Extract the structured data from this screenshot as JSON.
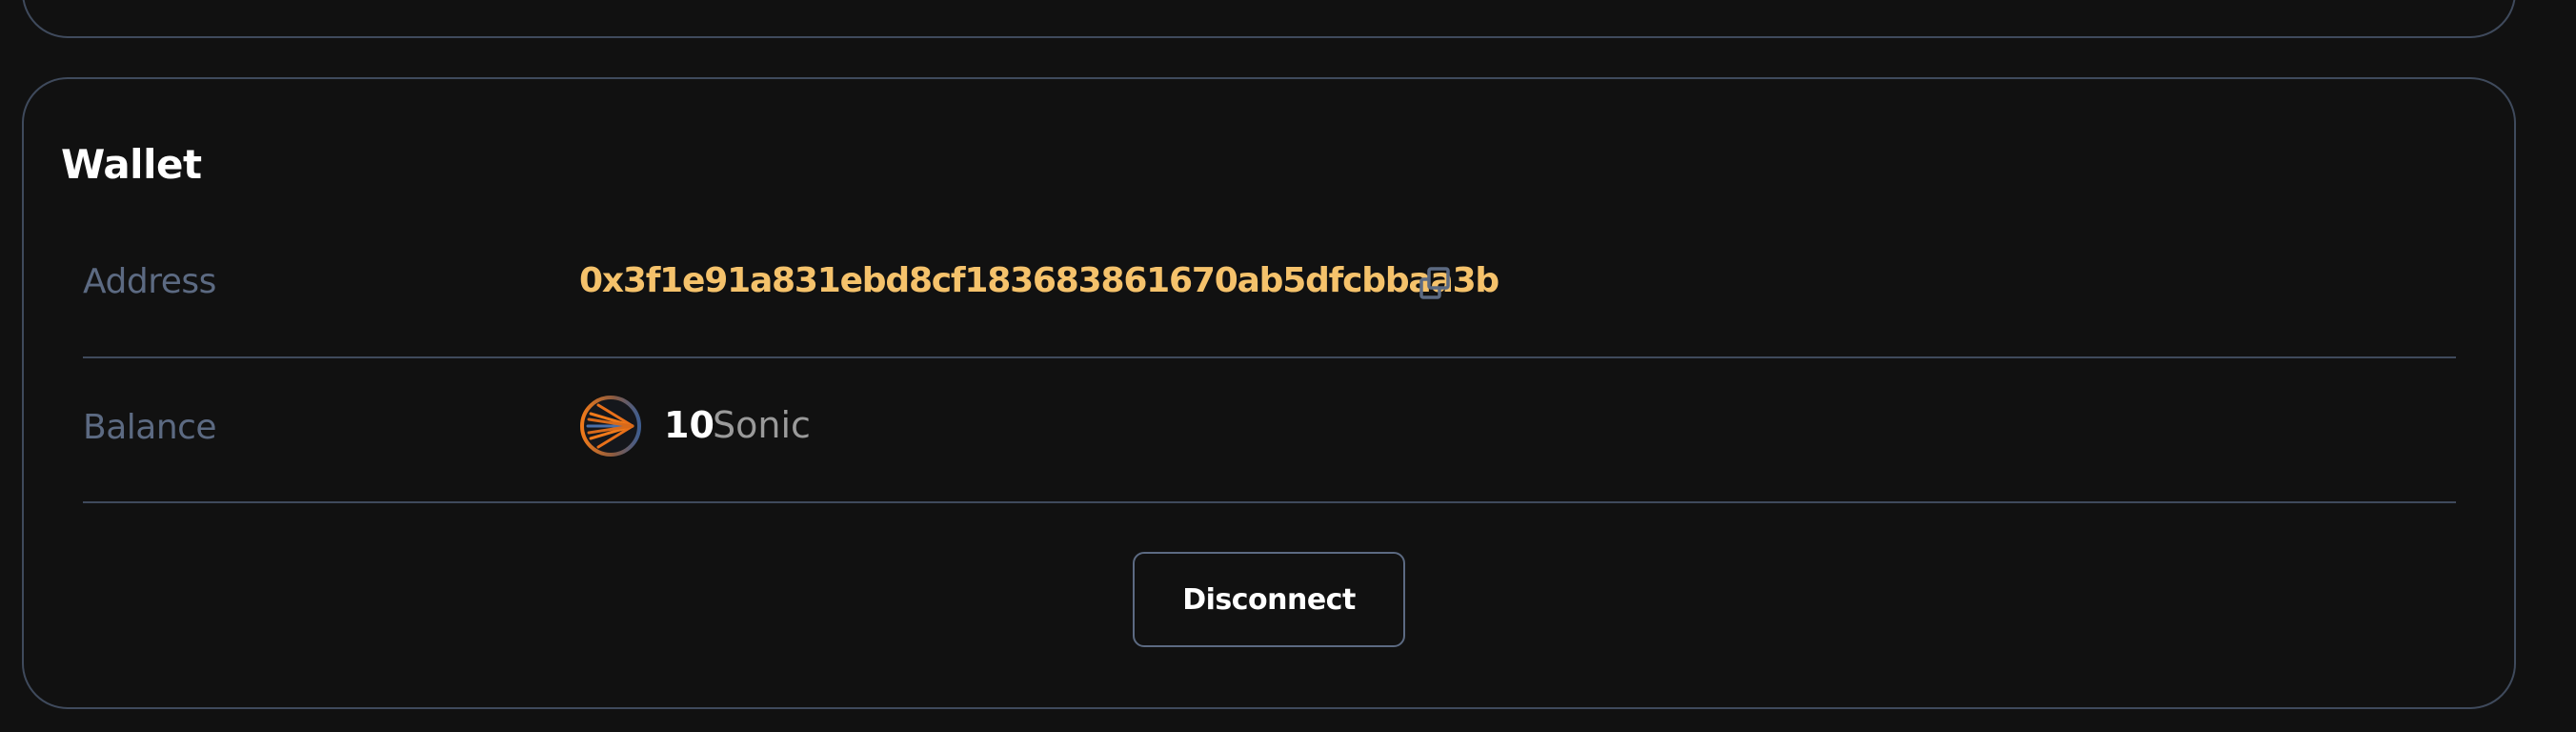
{
  "wallet": {
    "title": "Wallet",
    "address_label": "Address",
    "address_value": "0x3f1e91a831ebd8cf183683861670ab5dfcbbaa3b",
    "copy_icon": "copy-icon",
    "balance_label": "Balance",
    "balance_amount": "10",
    "balance_unit": "Sonic",
    "token_icon": "sonic-token-icon",
    "disconnect_label": "Disconnect"
  },
  "colors": {
    "background": "#111111",
    "border": "#3f4a5c",
    "label": "#5c6a82",
    "address": "#f5c26b",
    "text": "#ffffff",
    "muted": "#9a9a9a",
    "token_orange": "#f07a1a",
    "token_blue": "#4a6fa8"
  }
}
